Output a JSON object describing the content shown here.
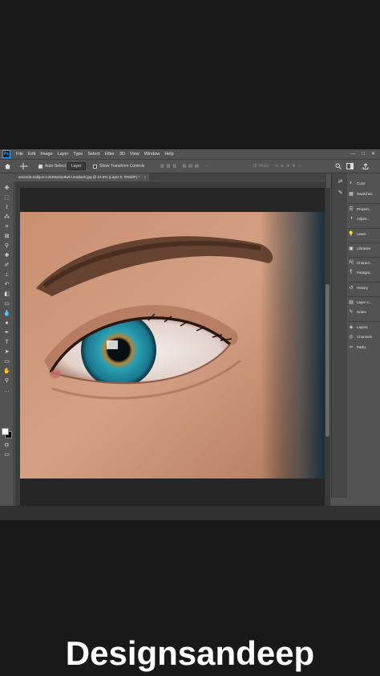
{
  "app": {
    "logo_text": "Ps",
    "menu": [
      "File",
      "Edit",
      "Image",
      "Layer",
      "Type",
      "Select",
      "Filter",
      "3D",
      "View",
      "Window",
      "Help"
    ],
    "window_controls": [
      "—",
      "□",
      "✕"
    ]
  },
  "options_bar": {
    "auto_select_label": "Auto-Select:",
    "auto_select_value": "Layer",
    "show_transform_label": "Show Transform Controls",
    "mode_3d_label": "3D Mode:"
  },
  "document_tab": {
    "title": "amanda-dalbjorn-UbJMy92p8wk-unsplash.jpg @ 24.8% (Layer 0, RGB/8*) *",
    "close": "×"
  },
  "panels": [
    {
      "icon": "color-icon",
      "glyph": "◐",
      "label": "Color"
    },
    {
      "icon": "swatches-icon",
      "glyph": "▦",
      "label": "Swatches"
    },
    {
      "icon": "properties-icon",
      "glyph": "☰",
      "label": "Propert..."
    },
    {
      "icon": "adjustments-icon",
      "glyph": "◑",
      "label": "Adjust..."
    },
    {
      "icon": "learn-icon",
      "glyph": "💡",
      "label": "Learn"
    },
    {
      "icon": "libraries-icon",
      "glyph": "▣",
      "label": "Libraries"
    },
    {
      "icon": "character-icon",
      "glyph": "A|",
      "label": "Charact..."
    },
    {
      "icon": "paragraph-icon",
      "glyph": "¶",
      "label": "Paragra..."
    },
    {
      "icon": "history-icon",
      "glyph": "↺",
      "label": "History"
    },
    {
      "icon": "layer-comps-icon",
      "glyph": "▤",
      "label": "Layer C..."
    },
    {
      "icon": "notes-icon",
      "glyph": "✎",
      "label": "Notes"
    },
    {
      "icon": "layers-icon",
      "glyph": "◈",
      "label": "Layers"
    },
    {
      "icon": "channels-icon",
      "glyph": "◎",
      "label": "Channels"
    },
    {
      "icon": "paths-icon",
      "glyph": "✑",
      "label": "Paths"
    }
  ],
  "tools": [
    {
      "icon": "move-tool-icon",
      "glyph": "✥"
    },
    {
      "icon": "marquee-tool-icon",
      "glyph": "⬚"
    },
    {
      "icon": "lasso-tool-icon",
      "glyph": "ℓ"
    },
    {
      "icon": "quick-select-tool-icon",
      "glyph": "⁂"
    },
    {
      "icon": "crop-tool-icon",
      "glyph": "⌗"
    },
    {
      "icon": "frame-tool-icon",
      "glyph": "⊠"
    },
    {
      "icon": "eyedropper-tool-icon",
      "glyph": "⚲"
    },
    {
      "icon": "healing-tool-icon",
      "glyph": "✚"
    },
    {
      "icon": "brush-tool-icon",
      "glyph": "✐"
    },
    {
      "icon": "clone-stamp-tool-icon",
      "glyph": "⊥"
    },
    {
      "icon": "history-brush-tool-icon",
      "glyph": "↶"
    },
    {
      "icon": "eraser-tool-icon",
      "glyph": "◧"
    },
    {
      "icon": "gradient-tool-icon",
      "glyph": "▭"
    },
    {
      "icon": "blur-tool-icon",
      "glyph": "💧"
    },
    {
      "icon": "dodge-tool-icon",
      "glyph": "●"
    },
    {
      "icon": "pen-tool-icon",
      "glyph": "✒"
    },
    {
      "icon": "type-tool-icon",
      "glyph": "T"
    },
    {
      "icon": "path-select-tool-icon",
      "glyph": "➤"
    },
    {
      "icon": "shape-tool-icon",
      "glyph": "▭"
    },
    {
      "icon": "hand-tool-icon",
      "glyph": "✋"
    },
    {
      "icon": "zoom-tool-icon",
      "glyph": "⚲"
    },
    {
      "icon": "more-tools-icon",
      "glyph": "…"
    }
  ],
  "watermark": "Designsandeep"
}
